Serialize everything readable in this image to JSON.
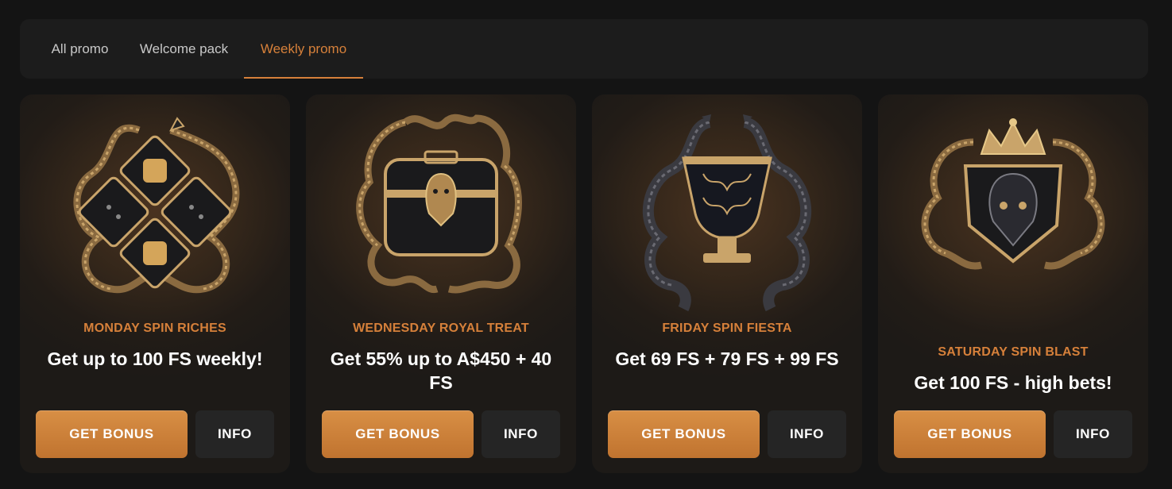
{
  "tabs": [
    {
      "label": "All promo",
      "active": false
    },
    {
      "label": "Welcome pack",
      "active": false
    },
    {
      "label": "Weekly promo",
      "active": true
    }
  ],
  "cards": [
    {
      "title": "MONDAY SPIN RICHES",
      "description": "Get up to 100 FS weekly!",
      "bonus_label": "GET BONUS",
      "info_label": "INFO",
      "image": "snake-dice-icon"
    },
    {
      "title": "WEDNESDAY ROYAL TREAT",
      "description": "Get 55% up to A$450 + 40 FS",
      "bonus_label": "GET BONUS",
      "info_label": "INFO",
      "image": "snake-chest-icon"
    },
    {
      "title": "FRIDAY SPIN FIESTA",
      "description": "Get 69 FS + 79 FS + 99 FS",
      "bonus_label": "GET BONUS",
      "info_label": "INFO",
      "image": "snake-goblet-icon"
    },
    {
      "title": "SATURDAY SPIN BLAST",
      "description": "Get 100 FS - high bets!",
      "bonus_label": "GET BONUS",
      "info_label": "INFO",
      "image": "snake-crown-icon"
    }
  ],
  "colors": {
    "accent": "#d6803a",
    "background": "#141414",
    "panel": "#1c1c1c",
    "button_bonus": "#c97d38",
    "button_info": "#252525"
  }
}
